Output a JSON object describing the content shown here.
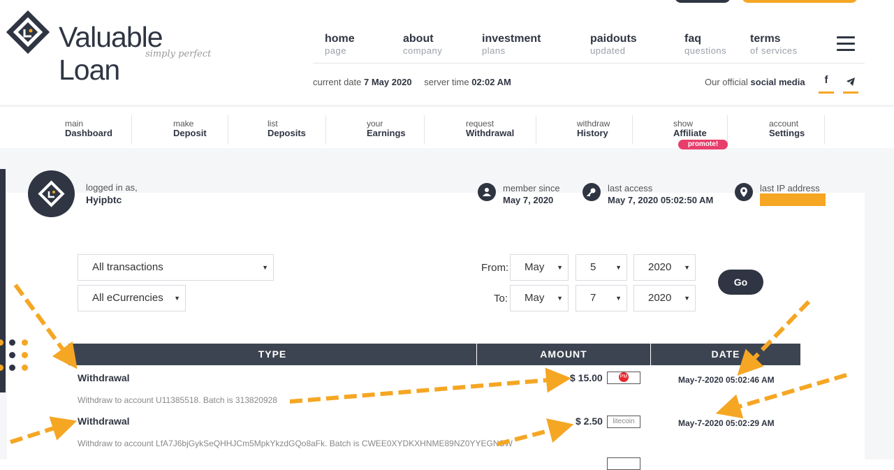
{
  "header": {
    "logo_text": "Valuable Loan",
    "logo_tagline": "simply perfect",
    "nav": [
      {
        "label": "home",
        "sub": "page"
      },
      {
        "label": "about",
        "sub": "company"
      },
      {
        "label": "investment",
        "sub": "plans"
      },
      {
        "label": "paidouts",
        "sub": "updated"
      },
      {
        "label": "faq",
        "sub": "questions"
      },
      {
        "label": "terms",
        "sub": "of services"
      }
    ],
    "current_date_label": "current date",
    "current_date": "7 May 2020",
    "server_time_label": "server time",
    "server_time": "02:02 AM",
    "social_label": "Our official",
    "social_strong": "social media",
    "social_icons": [
      "facebook-icon",
      "telegram-icon"
    ]
  },
  "member_nav": [
    {
      "small": "main",
      "label": "Dashboard"
    },
    {
      "small": "make",
      "label": "Deposit"
    },
    {
      "small": "list",
      "label": "Deposits"
    },
    {
      "small": "your",
      "label": "Earnings"
    },
    {
      "small": "request",
      "label": "Withdrawal"
    },
    {
      "small": "withdraw",
      "label": "History"
    },
    {
      "small": "show",
      "label": "Affiliate"
    },
    {
      "small": "account",
      "label": "Settings"
    }
  ],
  "promote_badge": "promote!",
  "account": {
    "logged_label": "logged in as,",
    "username": "Hyipbtc",
    "member_since_label": "member since",
    "member_since": "May 7, 2020",
    "last_access_label": "last access",
    "last_access": "May 7, 2020 05:02:50 AM",
    "last_ip_label": "last IP address"
  },
  "filters": {
    "type_value": "All transactions",
    "currency_value": "All eCurrencies",
    "from_label": "From:",
    "to_label": "To:",
    "from": {
      "month": "May",
      "day": "5",
      "year": "2020"
    },
    "to": {
      "month": "May",
      "day": "7",
      "year": "2020"
    },
    "go_label": "Go"
  },
  "table": {
    "headers": [
      "TYPE",
      "AMOUNT",
      "DATE"
    ],
    "rows": [
      {
        "type": "Withdrawal",
        "desc": "Withdraw to account U11385518. Batch is 313820928",
        "amount": "$ 15.00",
        "ecurrency": "PM",
        "date": "May-7-2020 05:02:46 AM"
      },
      {
        "type": "Withdrawal",
        "desc": "Withdraw to account LfA7J6bjGykSeQHHJCm5MpkYkzdGQo8aFk. Batch is CWEE0XYDKXHNME89NZ0YYEGNSW",
        "amount": "$ 2.50",
        "ecurrency": "litecoin",
        "date": "May-7-2020 05:02:29 AM"
      }
    ]
  },
  "colors": {
    "brand_dark": "#2f3542",
    "accent": "#f5a623",
    "promo": "#e83e6c"
  }
}
